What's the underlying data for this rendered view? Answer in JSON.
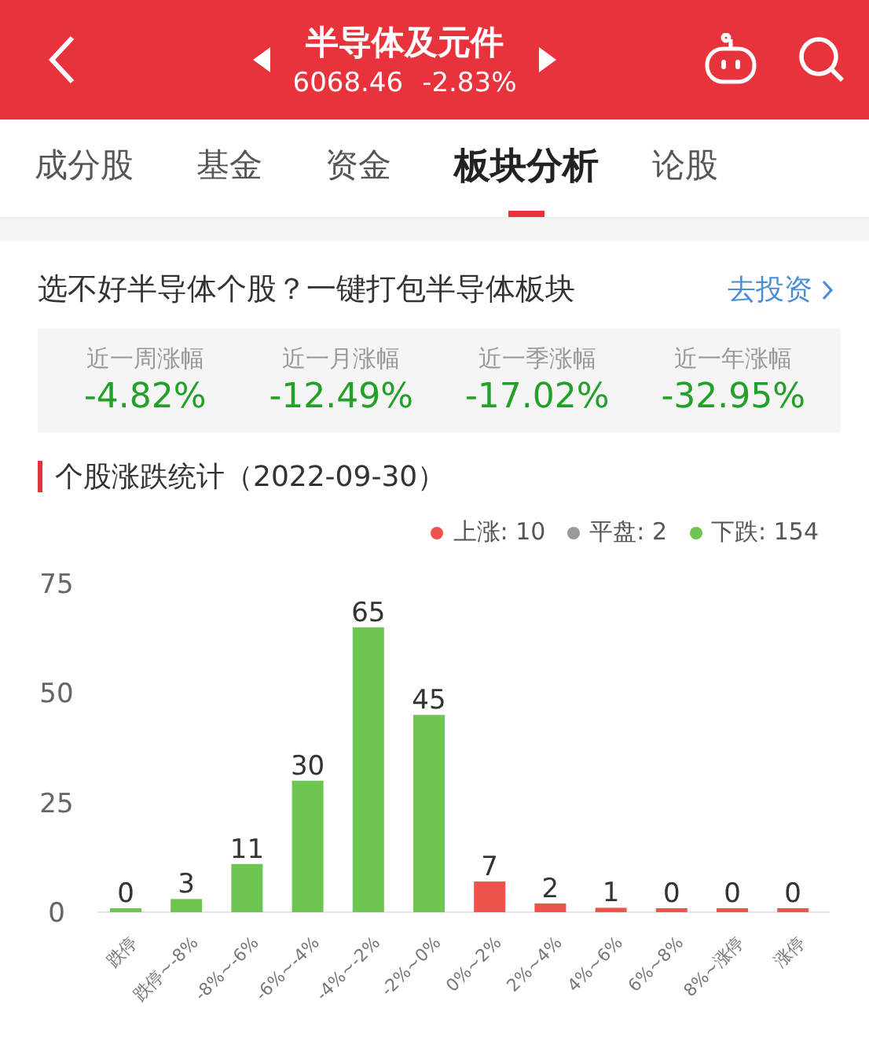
{
  "header": {
    "title": "半导体及元件",
    "price": "6068.46",
    "change": "-2.83%"
  },
  "tabs": [
    {
      "label": "成分股",
      "selected": false
    },
    {
      "label": "基金",
      "selected": false
    },
    {
      "label": "资金",
      "selected": false
    },
    {
      "label": "板块分析",
      "selected": true
    },
    {
      "label": "论股",
      "selected": false
    }
  ],
  "promo": {
    "text": "选不好半导体个股？一键打包半导体板块",
    "link": "去投资"
  },
  "returns": [
    {
      "label": "近一周涨幅",
      "value": "-4.82%"
    },
    {
      "label": "近一月涨幅",
      "value": "-12.49%"
    },
    {
      "label": "近一季涨幅",
      "value": "-17.02%"
    },
    {
      "label": "近一年涨幅",
      "value": "-32.95%"
    }
  ],
  "section_title": "个股涨跌统计（2022-09-30）",
  "chart_data": {
    "type": "bar",
    "data_labels": true,
    "categories": [
      "跌停",
      "跌停~-8%",
      "-8%~-6%",
      "-6%~-4%",
      "-4%~-2%",
      "-2%~0%",
      "0%~2%",
      "2%~4%",
      "4%~6%",
      "6%~8%",
      "8%~涨停",
      "涨停"
    ],
    "ylim": [
      0,
      75
    ],
    "yticks": [
      0,
      25,
      50,
      75
    ],
    "series": [
      {
        "name": "上涨: 10",
        "color": "#f0524c",
        "values": [
          null,
          null,
          null,
          null,
          null,
          null,
          7,
          2,
          1,
          0,
          0,
          0
        ]
      },
      {
        "name": "平盘: 2",
        "color": "#9a9a9a",
        "values": [
          null,
          null,
          null,
          null,
          null,
          null,
          null,
          null,
          null,
          null,
          null,
          null
        ]
      },
      {
        "name": "下跌: 154",
        "color": "#6cc651",
        "values": [
          0,
          3,
          11,
          30,
          65,
          45,
          null,
          null,
          null,
          null,
          null,
          null
        ]
      }
    ]
  }
}
